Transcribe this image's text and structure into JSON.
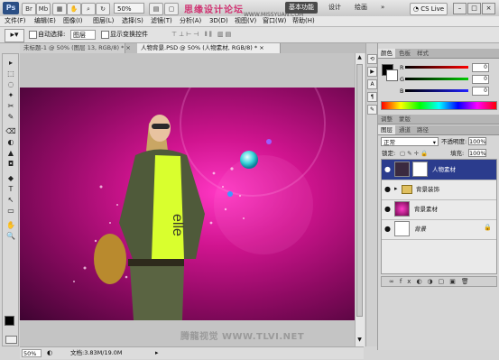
{
  "app": {
    "logo": "Ps",
    "zoom": "50%",
    "workspaces": [
      "基本功能",
      "设计",
      "绘画"
    ],
    "active_workspace": 0,
    "watermark_title": "思缘设计论坛",
    "watermark_url": "WWW.MISSYUAN.COM",
    "cs_live": "CS Live",
    "window_buttons": [
      "–",
      "□",
      "×"
    ]
  },
  "menubar": [
    "文件(F)",
    "编辑(E)",
    "图像(I)",
    "图层(L)",
    "选择(S)",
    "滤镜(T)",
    "分析(A)",
    "3D(D)",
    "视图(V)",
    "窗口(W)",
    "帮助(H)"
  ],
  "options": {
    "auto_select_label": "自动选择:",
    "auto_select_value": "图层",
    "show_transform_label": "显示变换控件"
  },
  "tabs": [
    {
      "label": "未标题-1 @ 50% (图层 13, RGB/8) *",
      "close": "×",
      "active": false
    },
    {
      "label": "人物背景.PSD @ 50% (人物素材, RGB/8) *",
      "close": "×",
      "active": true
    }
  ],
  "tools": [
    "▸",
    "⬚",
    "◌",
    "✦",
    "✂",
    "✎",
    "⌫",
    "◐",
    "▲",
    "◘",
    "◆",
    "T",
    "↖",
    "▭",
    "✋",
    "🔍"
  ],
  "canvas": {
    "watermark": "腾龍视觉 WWW.TLVI.NET"
  },
  "status": {
    "zoom": "50%",
    "doc_info": "文档:3.83M/19.0M"
  },
  "color_panel": {
    "tabs": [
      "颜色",
      "色板",
      "样式"
    ],
    "channels": [
      {
        "label": "R",
        "value": "0",
        "color": "#d22"
      },
      {
        "label": "G",
        "value": "0",
        "color": "#1a9a1a"
      },
      {
        "label": "B",
        "value": "0",
        "color": "#2233cc"
      }
    ]
  },
  "adjust_tabs": [
    "调整",
    "蒙版"
  ],
  "layers_panel": {
    "tabs": [
      "图层",
      "通道",
      "路径"
    ],
    "blend_mode": "正常",
    "opacity_label": "不透明度:",
    "opacity": "100%",
    "lock_label": "锁定:",
    "fill_label": "填充:",
    "fill": "100%",
    "layers": [
      {
        "name": "人物素材",
        "selected": true,
        "thumb": "#3b2a40"
      },
      {
        "name": "背景装饰",
        "selected": false,
        "thumb": "#cfcfcf"
      },
      {
        "name": "背景素材",
        "selected": false,
        "thumb": "#c0157f"
      },
      {
        "name": "背景",
        "selected": false,
        "thumb": "#ffffff"
      }
    ]
  }
}
